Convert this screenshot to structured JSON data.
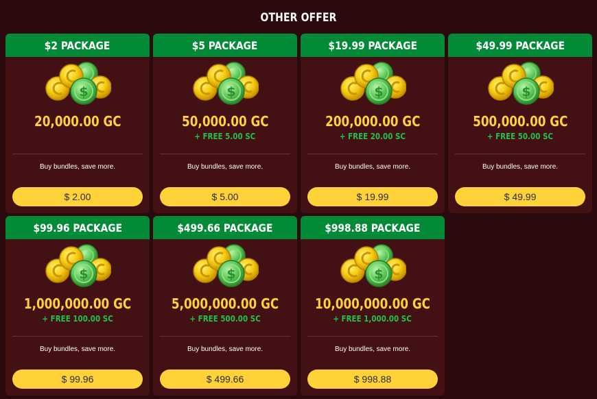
{
  "page": {
    "title": "OTHER OFFER"
  },
  "colors": {
    "background": "#2a0a0c",
    "card": "#431013",
    "header": "#038a37",
    "gold_text": "#ffd23a",
    "sc_text": "#22c04a",
    "button": "#ffd23a"
  },
  "icon": "coins-stack-icon",
  "packages": [
    {
      "name": "$2 PACKAGE",
      "gc": "20,000.00 GC",
      "bonus": "",
      "note": "Buy bundles, save more.",
      "price": "$ 2.00"
    },
    {
      "name": "$5 PACKAGE",
      "gc": "50,000.00 GC",
      "bonus": "+ FREE 5.00 SC",
      "note": "Buy bundles, save more.",
      "price": "$ 5.00"
    },
    {
      "name": "$19.99 PACKAGE",
      "gc": "200,000.00 GC",
      "bonus": "+ FREE 20.00 SC",
      "note": "Buy bundles, save more.",
      "price": "$ 19.99"
    },
    {
      "name": "$49.99 PACKAGE",
      "gc": "500,000.00 GC",
      "bonus": "+ FREE 50.00 SC",
      "note": "Buy bundles, save more.",
      "price": "$ 49.99"
    },
    {
      "name": "$99.96 PACKAGE",
      "gc": "1,000,000.00 GC",
      "bonus": "+ FREE 100.00 SC",
      "note": "Buy bundles, save more.",
      "price": "$ 99.96"
    },
    {
      "name": "$499.66 PACKAGE",
      "gc": "5,000,000.00 GC",
      "bonus": "+ FREE 500.00 SC",
      "note": "Buy bundles, save more.",
      "price": "$ 499.66"
    },
    {
      "name": "$998.88 PACKAGE",
      "gc": "10,000,000.00 GC",
      "bonus": "+ FREE 1,000.00 SC",
      "note": "Buy bundles, save more.",
      "price": "$ 998.88"
    }
  ]
}
